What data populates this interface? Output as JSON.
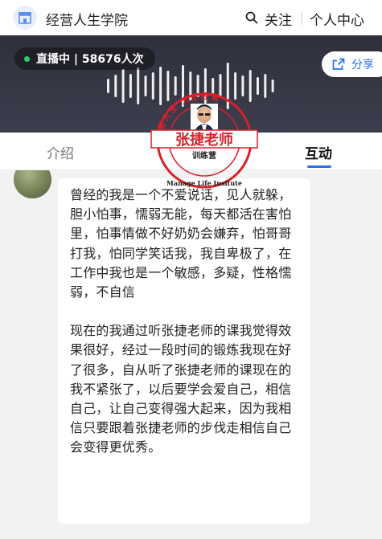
{
  "header": {
    "title": "经营人生学院",
    "follow": "关注",
    "personal_center": "个人中心"
  },
  "live": {
    "status": "直播中 | 58676人次",
    "share": "分享"
  },
  "tabs": {
    "intro": "介绍",
    "interact": "互动"
  },
  "stamp": {
    "ring_text": "经营人生 人生经营",
    "name": "张捷老师",
    "sub": "训练营",
    "english": "Manage Life Insitute"
  },
  "message": {
    "paragraph1": "曾经的我是一个不爱说话，见人就躲，胆小怕事，懦弱无能，每天都活在害怕里，怕事情做不好奶奶会嫌弃，怕哥哥打我，怕同学笑话我，我自卑极了，在工作中我也是一个敏感，多疑，性格懦弱，不自信",
    "paragraph2": "现在的我通过听张捷老师的课我觉得效果很好，经过一段时间的锻炼我现在好了很多，自从听了张捷老师的课现在的我不紧张了，以后要学会爱自己，相信自己，让自己变得强大起来，因为我相信只要跟着张捷老师的步伐走相信自己会变得更优秀。"
  },
  "colors": {
    "accent": "#2a6df4",
    "stamp_red": "#d8202a",
    "live_dot": "#2ecc71"
  },
  "icons": {
    "app": "shop-icon",
    "search": "search-icon",
    "share": "share-icon"
  }
}
